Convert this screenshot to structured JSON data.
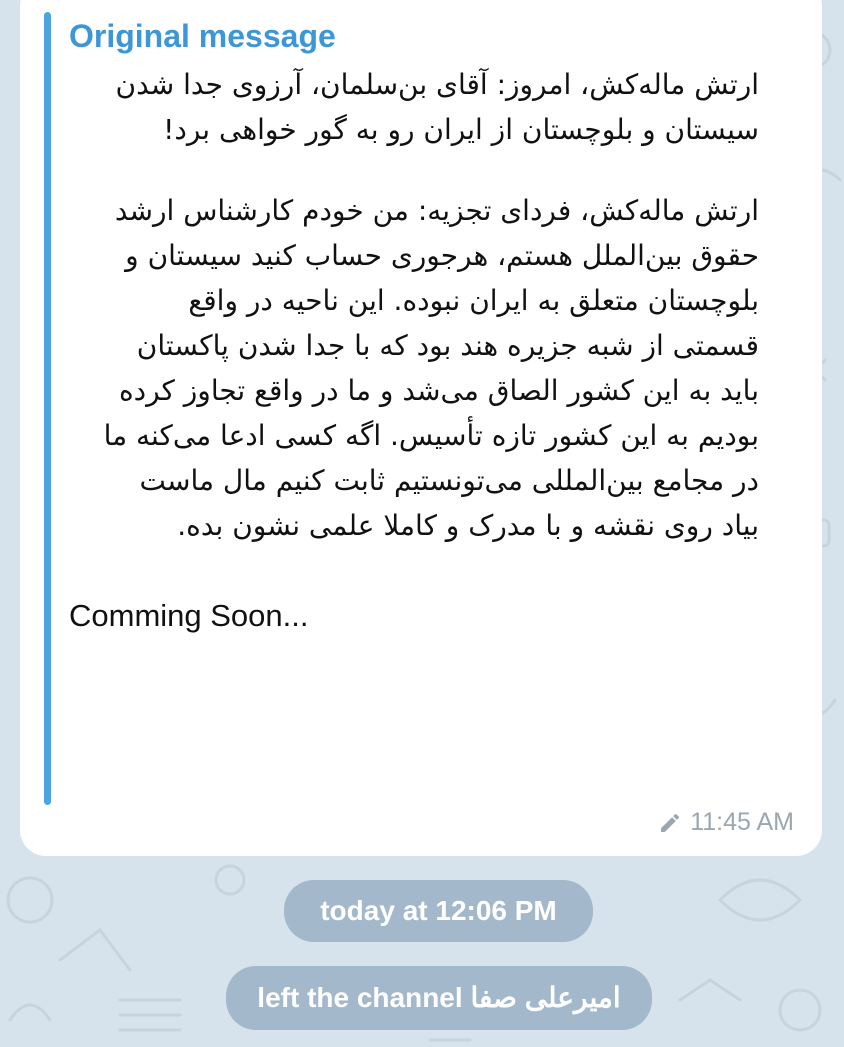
{
  "message": {
    "quote_title": "Original message",
    "paragraph_1": "ارتش ماله‌کش، امروز: آقای بن‌سلمان، آرزوی جدا شدن\nسیستان و بلوچستان از ایران رو به گور خواهی برد!",
    "paragraph_2": "ارتش ماله‌کش، فردای تجزیه: من خودم کارشناس ارشد\nحقوق بین‌الملل هستم، هرجوری حساب کنید سیستان و\nبلوچستان متعلق به ایران نبوده. این ناحیه در واقع\nقسمتی از شبه جزیره هند بود که با جدا شدن پاکستان\nباید به این کشور الصاق می‌شد و ما در واقع تجاوز کرده\nبودیم به این کشور تازه تأسیس. اگه کسی ادعا می‌کنه ما\nدر مجامع بین‌المللی می‌تونستیم ثابت کنیم مال ماست\nبیاد روی نقشه و با مدرک و کاملا علمی نشون بده.",
    "paragraph_3": "Comming Soon...",
    "time": "11:45 AM",
    "edited_icon": "pencil-icon"
  },
  "service": {
    "date_label": "today at 12:06 PM",
    "user_name": "امیرعلی صفا",
    "left_text": "left the channel"
  },
  "colors": {
    "background": "#d7e3ec",
    "accent": "#3d97d6",
    "bubble": "#ffffff",
    "meta": "#9aa7b2"
  }
}
